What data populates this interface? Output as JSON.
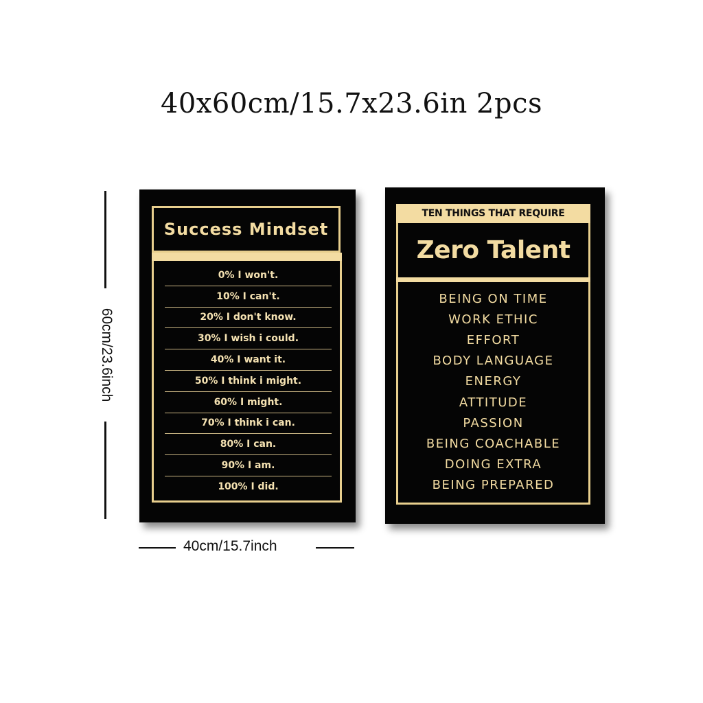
{
  "headline": "40x60cm/15.7x23.6in 2pcs",
  "dimensions": {
    "height_label": "60cm/23.6inch",
    "width_label": "40cm/15.7inch"
  },
  "colors": {
    "poster_background": "#050505",
    "gold": "#f3dca2"
  },
  "poster_left": {
    "title": "Success Mindset",
    "items": [
      "0% I won't.",
      "10% I can't.",
      "20% I don't know.",
      "30% I wish i could.",
      "40% I want it.",
      "50% I think i might.",
      "60% I might.",
      "70% I think i can.",
      "80% I can.",
      "90% I am.",
      "100% I did."
    ]
  },
  "poster_right": {
    "subtitle": "TEN THINGS THAT REQUIRE",
    "title": "Zero Talent",
    "items": [
      "BEING ON TIME",
      "WORK ETHIC",
      "EFFORT",
      "BODY LANGUAGE",
      "ENERGY",
      "ATTITUDE",
      "PASSION",
      "BEING COACHABLE",
      "DOING EXTRA",
      "BEING PREPARED"
    ]
  }
}
